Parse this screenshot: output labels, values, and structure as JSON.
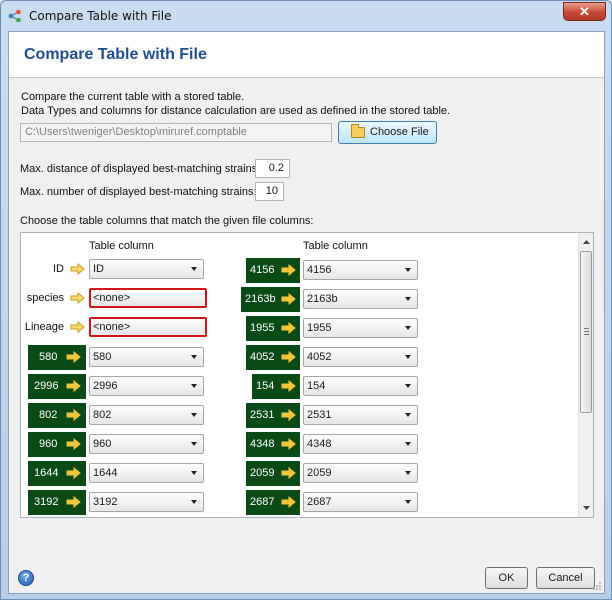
{
  "window": {
    "title": "Compare Table with File",
    "close_glyph": "✕"
  },
  "header": {
    "title": "Compare Table with File"
  },
  "description": {
    "line1": "Compare the current table with a stored table.",
    "line2": "Data Types and columns for distance calculation are used as defined in the stored table."
  },
  "file": {
    "path": "C:\\Users\\tweniger\\Desktop\\miruref.comptable",
    "choose_label": "Choose File",
    "icon": "folder-open-icon"
  },
  "settings": {
    "max_distance_label": "Max. distance of displayed best-matching strains:",
    "max_distance_value": "0.2",
    "max_number_label": "Max. number of displayed best-matching strains:",
    "max_number_value": "10"
  },
  "columns_section": {
    "label": "Choose the table columns that match the given file columns:",
    "left_header": "Table column",
    "right_header": "Table column",
    "plain_rows": [
      {
        "label": "ID",
        "value": "ID",
        "error": false
      },
      {
        "label": "species",
        "value": "<none>",
        "error": true
      },
      {
        "label": "Lineage",
        "value": "<none>",
        "error": true
      }
    ],
    "left_green_rows": [
      {
        "label": "580",
        "value": "580"
      },
      {
        "label": "2996",
        "value": "2996"
      },
      {
        "label": "802",
        "value": "802"
      },
      {
        "label": "960",
        "value": "960"
      },
      {
        "label": "1644",
        "value": "1644"
      },
      {
        "label": "3192",
        "value": "3192"
      }
    ],
    "right_rows": [
      {
        "label": "4156",
        "value": "4156"
      },
      {
        "label": "2163b",
        "value": "2163b"
      },
      {
        "label": "1955",
        "value": "1955"
      },
      {
        "label": "4052",
        "value": "4052"
      },
      {
        "label": "154",
        "value": "154"
      },
      {
        "label": "2531",
        "value": "2531"
      },
      {
        "label": "4348",
        "value": "4348"
      },
      {
        "label": "2059",
        "value": "2059"
      },
      {
        "label": "2687",
        "value": "2687"
      }
    ]
  },
  "buttons": {
    "ok": "OK",
    "cancel": "Cancel",
    "help_glyph": "?"
  },
  "colors": {
    "header_title": "#1f4e8c",
    "green_label_bg": "#0a4a16",
    "arrow": "#f3c53a",
    "error_border": "#d01818"
  }
}
